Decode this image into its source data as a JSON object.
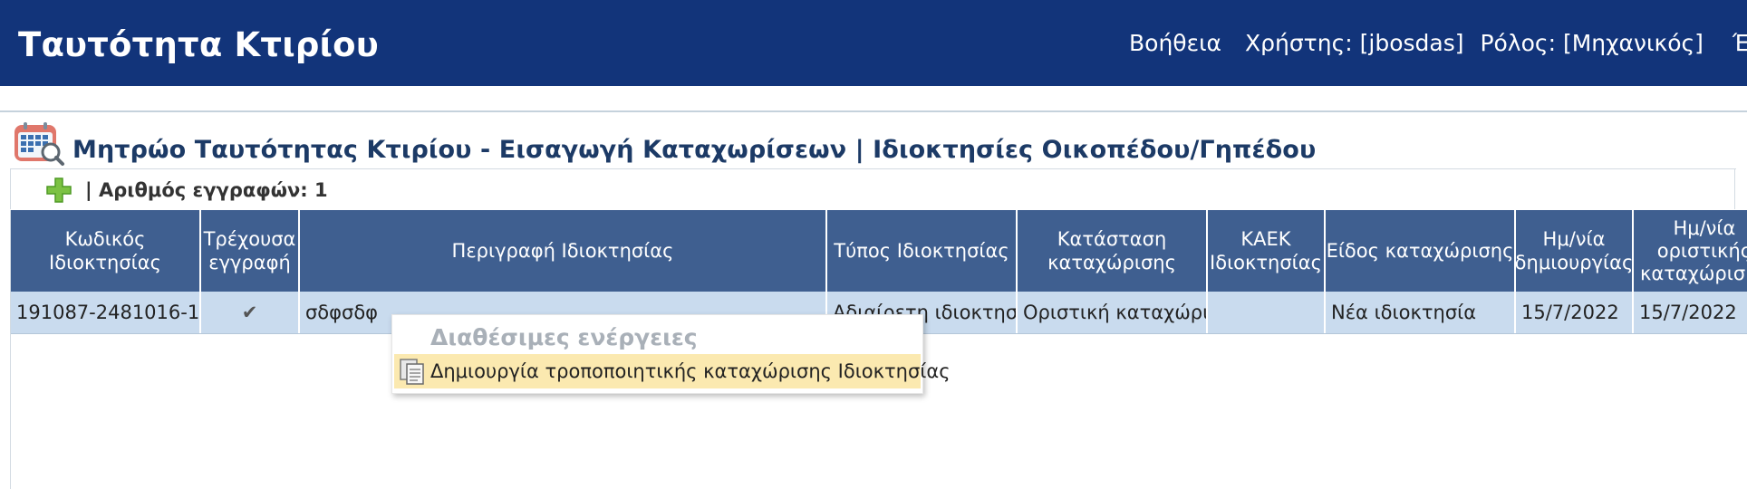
{
  "header": {
    "app_title": "Ταυτότητα Κτιρίου",
    "help": "Βοήθεια",
    "user": "Χρήστης: [jbosdas]",
    "role": "Ρόλος: [Μηχανικός]",
    "logout": "Έξοδος"
  },
  "page": {
    "title": "Μητρώο Ταυτότητας Κτιρίου - Εισαγωγή Καταχωρίσεων | Ιδιοκτησίες Οικοπέδου/Γηπέδου"
  },
  "toolbar": {
    "record_count": "| Αριθμός εγγραφών: 1"
  },
  "table": {
    "columns": [
      "Κωδικός Ιδιοκτησίας",
      "Τρέχουσα\nεγγραφή",
      "Περιγραφή Ιδιοκτησίας",
      "Τύπος Ιδιοκτησίας",
      "Κατάσταση\nκαταχώρισης",
      "ΚΑΕΚ\nΙδιοκτησίας",
      "Είδος καταχώρισης",
      "Ημ/νία\nδημιουργίας",
      "Ημ/νία\nοριστικής\nκαταχώρισης"
    ],
    "rows": [
      {
        "code": "191087-2481016-1",
        "current": "✔",
        "description": "σδφσδφ",
        "type": "Αδιαίρετη ιδιοκτησία",
        "status": "Οριστική καταχώριση",
        "kaek": "",
        "entry_kind": "Νέα ιδιοκτησία",
        "created": "15/7/2022",
        "finalized": "15/7/2022"
      }
    ]
  },
  "context_menu": {
    "header": "Διαθέσιμες ενέργειες",
    "items": [
      {
        "label": "Δημιουργία τροποποιητικής καταχώρισης Ιδιοκτησίας"
      }
    ]
  }
}
